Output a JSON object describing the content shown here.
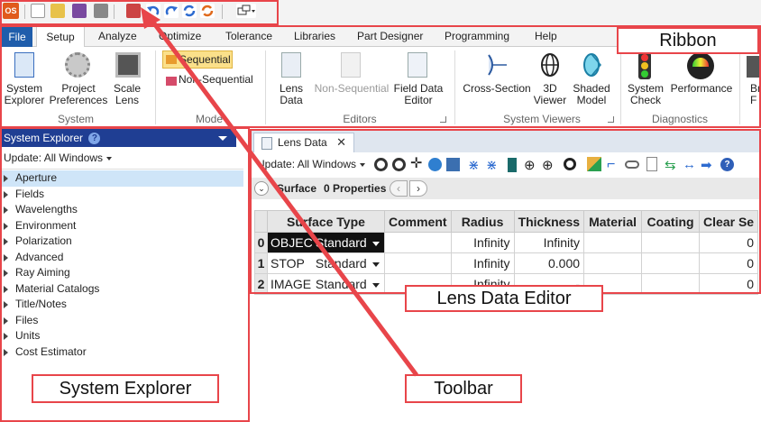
{
  "app": {
    "logo_text": "OS"
  },
  "quick_access": {
    "icons": [
      "app-logo-icon",
      "new-file-icon",
      "open-file-icon",
      "save-icon",
      "print-icon",
      "shaded-model-icon",
      "undo-icon",
      "redo-icon",
      "refresh-icon",
      "update-icon",
      "window-layout-icon"
    ]
  },
  "menubar": {
    "tabs": [
      "File",
      "Setup",
      "Analyze",
      "Optimize",
      "Tolerance",
      "Libraries",
      "Part Designer",
      "Programming",
      "Help"
    ]
  },
  "ribbon": {
    "buttons": {
      "system_explorer": [
        "System",
        "Explorer"
      ],
      "project_preferences": [
        "Project",
        "Preferences"
      ],
      "scale_lens": [
        "Scale",
        "Lens"
      ],
      "sequential": "Sequential",
      "non_sequential_mode": "Non-Sequential",
      "lens_data": [
        "Lens",
        "Data"
      ],
      "non_sequential_editor": "Non-Sequential",
      "field_data_editor": [
        "Field Data",
        "Editor"
      ],
      "cross_section": "Cross-Section",
      "viewer_3d": [
        "3D",
        "Viewer"
      ],
      "shaded_model": [
        "Shaded",
        "Model"
      ],
      "system_check": [
        "System",
        "Check"
      ],
      "performance": "Performance",
      "partial_br": [
        "Br",
        "F"
      ]
    },
    "groups": [
      "System",
      "Mode",
      "Editors",
      "System Viewers",
      "Diagnostics"
    ]
  },
  "system_explorer": {
    "title": "System Explorer",
    "update_label": "Update: All Windows",
    "items": [
      "Aperture",
      "Fields",
      "Wavelengths",
      "Environment",
      "Polarization",
      "Advanced",
      "Ray Aiming",
      "Material Catalogs",
      "Title/Notes",
      "Files",
      "Units",
      "Cost Estimator"
    ]
  },
  "lens_data_editor": {
    "tab_title": "Lens Data",
    "update_label": "Update: All Windows",
    "surface_label": "Surface",
    "properties_label": "0 Properties",
    "columns": [
      "Surface Type",
      "Comment",
      "Radius",
      "Thickness",
      "Material",
      "Coating",
      "Clear Se"
    ],
    "rows": [
      {
        "num": "0",
        "name": "OBJECT",
        "type": "Standard",
        "comment": "",
        "radius": "Infinity",
        "thickness": "Infinity",
        "material": "",
        "coating": "",
        "clear": "0"
      },
      {
        "num": "1",
        "name": "STOP",
        "type": "Standard",
        "comment": "",
        "radius": "Infinity",
        "thickness": "0.000",
        "material": "",
        "coating": "",
        "clear": "0"
      },
      {
        "num": "2",
        "name": "IMAGE",
        "type": "Standard",
        "comment": "",
        "radius": "Infinity",
        "thickness": "-",
        "material": "",
        "coating": "",
        "clear": "0"
      }
    ]
  },
  "callouts": {
    "ribbon": "Ribbon",
    "system_explorer": "System Explorer",
    "lens_data_editor": "Lens Data Editor",
    "toolbar": "Toolbar"
  },
  "colors": {
    "accent": "#e8454a",
    "file_tab": "#1f5dab",
    "explorer_header": "#1f3e93"
  }
}
